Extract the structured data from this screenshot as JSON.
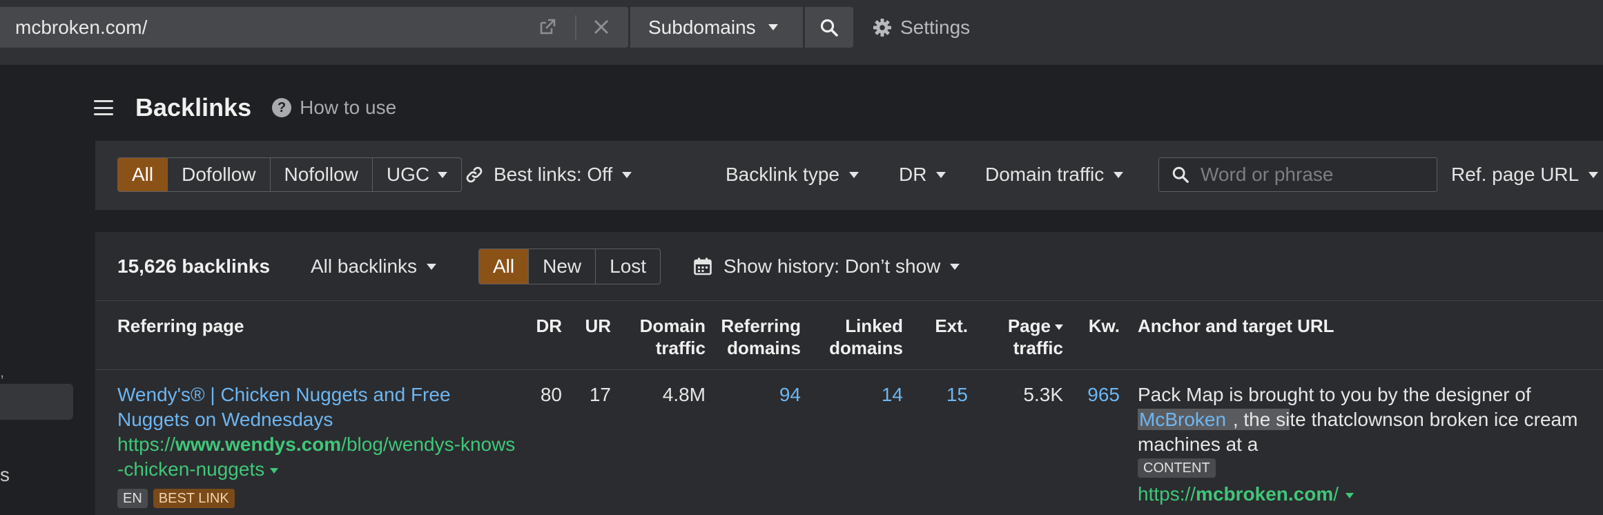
{
  "topbar": {
    "url_value": "mcbroken.com/",
    "mode_label": "Subdomains",
    "settings_label": "Settings"
  },
  "sidebar": {
    "partial_label": "s"
  },
  "header": {
    "title": "Backlinks",
    "how_to_use": "How to use"
  },
  "filters": {
    "link_types": [
      "All",
      "Dofollow",
      "Nofollow",
      "UGC"
    ],
    "best_links": "Best links: Off",
    "backlink_type": "Backlink type",
    "dr": "DR",
    "domain_traffic": "Domain traffic",
    "search_placeholder": "Word or phrase",
    "ref_page_url": "Ref. page URL"
  },
  "summary": {
    "count": "15,626 backlinks",
    "all_backlinks": "All backlinks",
    "states": [
      "All",
      "New",
      "Lost"
    ],
    "history": "Show history: Don’t show"
  },
  "table": {
    "columns": {
      "referring_page": "Referring page",
      "dr": "DR",
      "ur": "UR",
      "domain_traffic_1": "Domain",
      "domain_traffic_2": "traffic",
      "referring_domains_1": "Referring",
      "referring_domains_2": "domains",
      "linked_domains_1": "Linked",
      "linked_domains_2": "domains",
      "ext": "Ext.",
      "page_traffic_1": "Page",
      "page_traffic_2": "traffic",
      "kw": "Kw.",
      "anchor": "Anchor and target URL"
    },
    "rows": [
      {
        "title": "Wendy's® | Chicken Nuggets and Free Nuggets on Wednesdays",
        "url_prefix": "https://",
        "url_domain": "www.wendys.com",
        "url_path": "/blog/wendys-knows-chicken-nuggets",
        "tag_lang": "EN",
        "tag_best": "BEST LINK",
        "dr": "80",
        "ur": "17",
        "domain_traffic": "4.8M",
        "referring_domains": "94",
        "linked_domains": "14",
        "ext": "15",
        "page_traffic": "5.3K",
        "kw": "965",
        "anchor_before": "Pack Map is brought to you by the designer of",
        "anchor_keyword": "McBroken",
        "anchor_hl": " , the si",
        "anchor_after": "te thatclownson broken ice cream machines at a",
        "anchor_tag": "CONTENT",
        "target_prefix": "https://",
        "target_domain": "mcbroken.com",
        "target_path": "/"
      }
    ]
  }
}
